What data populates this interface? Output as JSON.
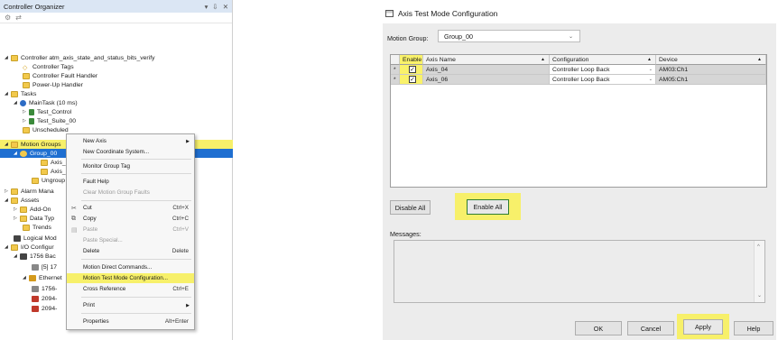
{
  "organizer": {
    "title": "Controller Organizer",
    "window_controls": [
      "▾",
      "⇩",
      "✕"
    ],
    "toolbar_icons": [
      "⚙",
      "⇄"
    ],
    "tree": [
      {
        "label": "Controller atm_axis_state_and_status_bits_verify",
        "icon": "controller-folder-icon"
      },
      {
        "label": "Controller Tags",
        "icon": "tag-icon"
      },
      {
        "label": "Controller Fault Handler",
        "icon": "folder-icon"
      },
      {
        "label": "Power-Up Handler",
        "icon": "folder-icon"
      },
      {
        "label": "Tasks",
        "icon": "folder-icon"
      },
      {
        "label": "MainTask (10 ms)",
        "icon": "clock-icon"
      },
      {
        "label": "Test_Control",
        "icon": "program-icon"
      },
      {
        "label": "Test_Suite_00",
        "icon": "program-icon"
      },
      {
        "label": "Unscheduled",
        "icon": "folder-icon"
      },
      {
        "label": "Motion Groups",
        "icon": "folder-icon"
      },
      {
        "label": "Group_00",
        "icon": "motion-group-icon"
      },
      {
        "label": "Axis_",
        "icon": "axis-icon"
      },
      {
        "label": "Axis_",
        "icon": "axis-icon"
      },
      {
        "label": "Ungroup",
        "icon": "folder-icon"
      },
      {
        "label": "Alarm Mana",
        "icon": "folder-icon"
      },
      {
        "label": "Assets",
        "icon": "folder-icon"
      },
      {
        "label": "Add-On",
        "icon": "folder-icon"
      },
      {
        "label": "Data Typ",
        "icon": "folder-icon"
      },
      {
        "label": "Trends",
        "icon": "folder-icon"
      },
      {
        "label": "Logical Mod",
        "icon": "logical-model-icon"
      },
      {
        "label": "I/O Configur",
        "icon": "folder-icon"
      },
      {
        "label": "1756 Bac",
        "icon": "chassis-icon"
      },
      {
        "label": "[5] 17",
        "icon": "module-icon"
      },
      {
        "label": "Ethernet",
        "icon": "ethernet-icon"
      },
      {
        "label": "1756-",
        "icon": "module-icon"
      },
      {
        "label": "2094-",
        "icon": "drive-icon"
      },
      {
        "label": "2094-",
        "icon": "drive-icon"
      }
    ]
  },
  "context_menu": {
    "items": [
      {
        "label": "New Axis",
        "shortcut": "",
        "disabled": false,
        "submenu": true
      },
      {
        "label": "New Coordinate System...",
        "shortcut": "",
        "disabled": false
      },
      {
        "label": "Monitor Group Tag",
        "shortcut": "",
        "disabled": false
      },
      {
        "label": "Fault Help",
        "shortcut": "",
        "disabled": false
      },
      {
        "label": "Clear Motion Group Faults",
        "shortcut": "",
        "disabled": true
      },
      {
        "label": "Cut",
        "shortcut": "Ctrl+X",
        "disabled": false
      },
      {
        "label": "Copy",
        "shortcut": "Ctrl+C",
        "disabled": false
      },
      {
        "label": "Paste",
        "shortcut": "Ctrl+V",
        "disabled": true
      },
      {
        "label": "Paste Special...",
        "shortcut": "",
        "disabled": true
      },
      {
        "label": "Delete",
        "shortcut": "Delete",
        "disabled": false
      },
      {
        "label": "Motion Direct Commands...",
        "shortcut": "",
        "disabled": false
      },
      {
        "label": "Motion Test Mode Configuration...",
        "shortcut": "",
        "disabled": false,
        "highlighted": true
      },
      {
        "label": "Cross Reference",
        "shortcut": "Ctrl+E",
        "disabled": false
      },
      {
        "label": "Print",
        "shortcut": "",
        "disabled": false,
        "submenu": true
      },
      {
        "label": "Properties",
        "shortcut": "Alt+Enter",
        "disabled": false
      }
    ]
  },
  "dialog": {
    "title": "Axis Test Mode Configuration",
    "motion_group_label": "Motion Group:",
    "motion_group_value": "Group_00",
    "columns": [
      "Enable",
      "Axis Name",
      "Configuration",
      "Device"
    ],
    "rows": [
      {
        "marker": "*",
        "enabled": true,
        "axis": "Axis_04",
        "configuration": "Controller Loop Back",
        "device": "AM03:Ch1"
      },
      {
        "marker": "*",
        "enabled": true,
        "axis": "Axis_06",
        "configuration": "Controller Loop Back",
        "device": "AM05:Ch1"
      }
    ],
    "disable_all_label": "Disable All",
    "enable_all_label": "Enable All",
    "messages_label": "Messages:",
    "ok_label": "OK",
    "cancel_label": "Cancel",
    "apply_label": "Apply",
    "help_label": "Help"
  },
  "colors": {
    "highlight_yellow": "#f7f06a",
    "selection_blue": "#1f6fd1",
    "enable_all_border": "#2e7d32"
  }
}
